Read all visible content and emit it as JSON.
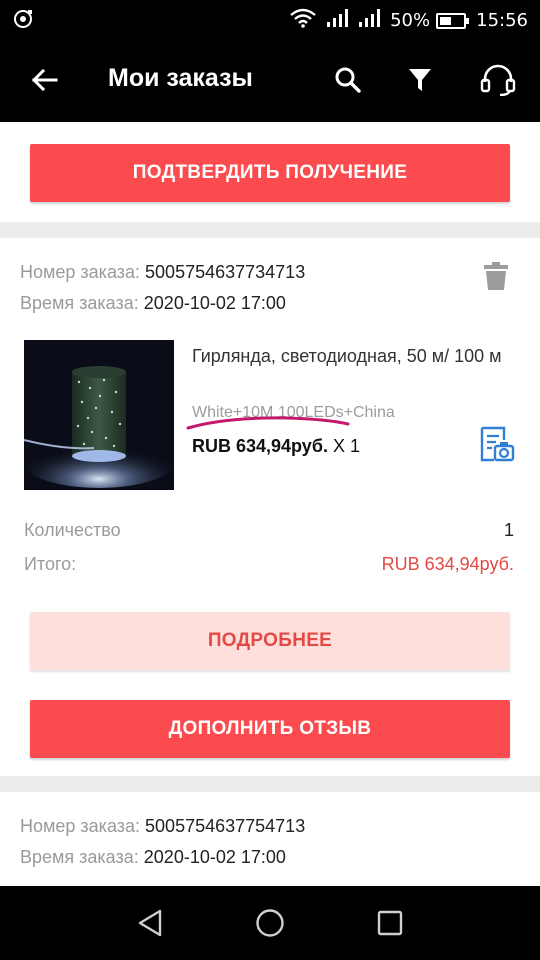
{
  "status_bar": {
    "battery_percent": "50%",
    "battery_level": 0.5,
    "time": "15:56"
  },
  "app_bar": {
    "title": "Мои заказы",
    "icons": [
      "back-arrow-icon",
      "search-icon",
      "filter-icon",
      "headset-icon"
    ]
  },
  "top_card": {
    "confirm_button": "ПОДТВЕРДИТЬ ПОЛУЧЕНИЕ"
  },
  "order1": {
    "number_label": "Номер заказа:",
    "number": "5005754637734713",
    "time_label": "Время заказа:",
    "time": "2020-10-02 17:00",
    "product_name": "Гирлянда, светодиодная, 50 м/ 100 м",
    "variant": "White+10M 100LEDs+China",
    "price": "RUB 634,94руб.",
    "quantity_mult": "X 1",
    "quantity_label": "Количество",
    "quantity_value": "1",
    "total_label": "Итого:",
    "total_value": "RUB 634,94руб.",
    "details_button": "ПОДРОБНЕЕ",
    "review_button": "ДОПОЛНИТЬ ОТЗЫВ"
  },
  "order2": {
    "number_label": "Номер заказа:",
    "number": "5005754637754713",
    "time_label": "Время заказа:",
    "time": "2020-10-02 17:00"
  },
  "colors": {
    "accent_red": "#fb4b4f",
    "total_red": "#e34a45",
    "pink_button": "#fde0dc",
    "link_blue": "#2f7fd6",
    "underline_magenta": "#c4186d"
  },
  "nav_bar": {
    "icons": [
      "back-triangle-icon",
      "home-circle-icon",
      "recents-square-icon"
    ]
  }
}
